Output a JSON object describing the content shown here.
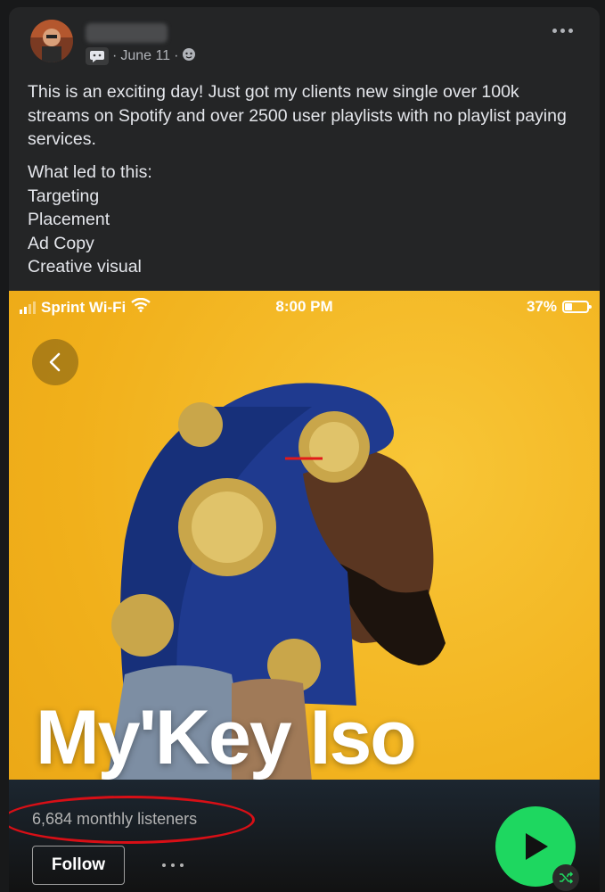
{
  "post": {
    "author_name": "",
    "date": "June 11",
    "separator": "·",
    "body_prefix": "This is an exciting day! Just got my clients new single over ",
    "highlight_1": "100k streams on Spotify",
    "body_middle": " and over 2500 user playlists with ",
    "highlight_2": "no playlist paying services.",
    "steps_heading": "What led to this:",
    "steps": [
      "Targeting",
      "Placement",
      "Ad Copy",
      "Creative visual"
    ]
  },
  "icons": {
    "menu": "more-horizontal-icon",
    "audience": "globe-icon",
    "messenger": "chat-bubble-icon"
  },
  "phone": {
    "carrier": "Sprint Wi-Fi",
    "time": "8:00 PM",
    "battery": "37%"
  },
  "spotify": {
    "artist": "My'Key Iso",
    "monthly_listeners": "6,684 monthly listeners",
    "follow_label": "Follow",
    "accent_color": "#1ed760",
    "annotation_color": "#d80f16"
  }
}
